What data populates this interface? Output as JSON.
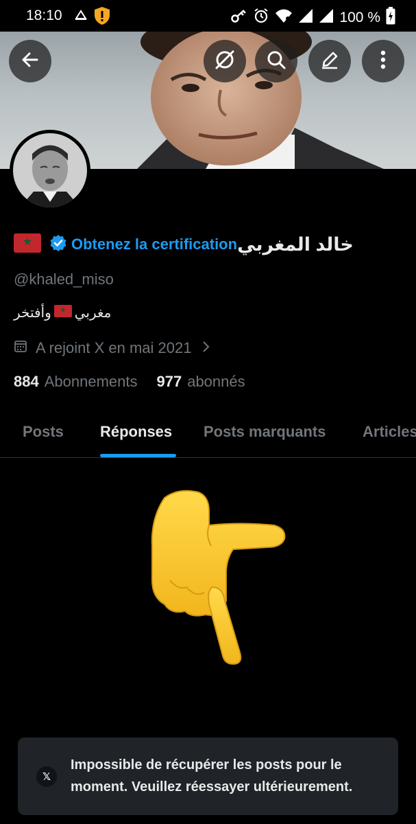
{
  "status_bar": {
    "time": "18:10",
    "battery": "100 %",
    "icons": [
      "app-notification-icon",
      "shield-warning-icon",
      "key-icon",
      "alarm-icon",
      "wifi-icon",
      "signal-icon",
      "signal-icon",
      "battery-charging-icon"
    ]
  },
  "header": {
    "back_icon": "arrow-left-icon",
    "actions": [
      "grok-icon",
      "search-icon",
      "edit-icon",
      "more-icon"
    ]
  },
  "profile": {
    "flag": "🇲🇦",
    "verified_cta": "Obtenez la certification",
    "display_name": "خالد المغربي",
    "handle": "@khaled_miso",
    "bio_start": "مغربي",
    "bio_flag": "🇲🇦",
    "bio_end": "وأفتخر",
    "joined": "A rejoint X en mai 2021",
    "following_count": "884",
    "following_label": "Abonnements",
    "followers_count": "977",
    "followers_label": "abonnés"
  },
  "tabs": [
    "Posts",
    "Réponses",
    "Posts marquants",
    "Articles"
  ],
  "active_tab": "Réponses",
  "toast": {
    "icon_label": "𝕏",
    "message": "Impossible de récupérer les posts pour le moment. Veuillez réessayer ultérieurement."
  },
  "colors": {
    "accent": "#1d9bf0",
    "background": "#000000",
    "muted_text": "#71767b",
    "toast_bg": "#202327"
  }
}
